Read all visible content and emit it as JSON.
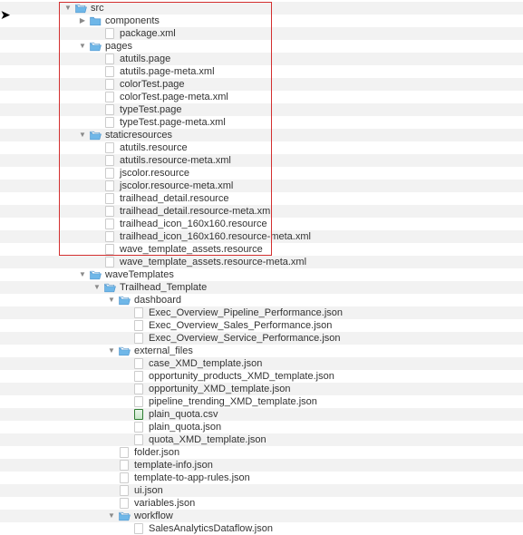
{
  "tree": [
    {
      "depth": 0,
      "arrow": "down",
      "icon": "folder-open",
      "label": "src",
      "interactable": true
    },
    {
      "depth": 1,
      "arrow": "right",
      "icon": "folder-closed",
      "label": "components",
      "interactable": true
    },
    {
      "depth": 2,
      "arrow": "",
      "icon": "file",
      "label": "package.xml",
      "interactable": true
    },
    {
      "depth": 1,
      "arrow": "down",
      "icon": "folder-open",
      "label": "pages",
      "interactable": true
    },
    {
      "depth": 2,
      "arrow": "",
      "icon": "file",
      "label": "atutils.page",
      "interactable": true
    },
    {
      "depth": 2,
      "arrow": "",
      "icon": "file",
      "label": "atutils.page-meta.xml",
      "interactable": true
    },
    {
      "depth": 2,
      "arrow": "",
      "icon": "file",
      "label": "colorTest.page",
      "interactable": true
    },
    {
      "depth": 2,
      "arrow": "",
      "icon": "file",
      "label": "colorTest.page-meta.xml",
      "interactable": true
    },
    {
      "depth": 2,
      "arrow": "",
      "icon": "file",
      "label": "typeTest.page",
      "interactable": true
    },
    {
      "depth": 2,
      "arrow": "",
      "icon": "file",
      "label": "typeTest.page-meta.xml",
      "interactable": true
    },
    {
      "depth": 1,
      "arrow": "down",
      "icon": "folder-open",
      "label": "staticresources",
      "interactable": true
    },
    {
      "depth": 2,
      "arrow": "",
      "icon": "file",
      "label": "atutils.resource",
      "interactable": true
    },
    {
      "depth": 2,
      "arrow": "",
      "icon": "file",
      "label": "atutils.resource-meta.xml",
      "interactable": true
    },
    {
      "depth": 2,
      "arrow": "",
      "icon": "file",
      "label": "jscolor.resource",
      "interactable": true
    },
    {
      "depth": 2,
      "arrow": "",
      "icon": "file",
      "label": "jscolor.resource-meta.xml",
      "interactable": true
    },
    {
      "depth": 2,
      "arrow": "",
      "icon": "file",
      "label": "trailhead_detail.resource",
      "interactable": true
    },
    {
      "depth": 2,
      "arrow": "",
      "icon": "file",
      "label": "trailhead_detail.resource-meta.xml",
      "interactable": true
    },
    {
      "depth": 2,
      "arrow": "",
      "icon": "file",
      "label": "trailhead_icon_160x160.resource",
      "interactable": true
    },
    {
      "depth": 2,
      "arrow": "",
      "icon": "file",
      "label": "trailhead_icon_160x160.resource-meta.xml",
      "interactable": true
    },
    {
      "depth": 2,
      "arrow": "",
      "icon": "file",
      "label": "wave_template_assets.resource",
      "interactable": true
    },
    {
      "depth": 2,
      "arrow": "",
      "icon": "file",
      "label": "wave_template_assets.resource-meta.xml",
      "interactable": true
    },
    {
      "depth": 1,
      "arrow": "down",
      "icon": "folder-open",
      "label": "waveTemplates",
      "interactable": true
    },
    {
      "depth": 2,
      "arrow": "down",
      "icon": "folder-open",
      "label": "Trailhead_Template",
      "interactable": true
    },
    {
      "depth": 3,
      "arrow": "down",
      "icon": "folder-open",
      "label": "dashboard",
      "interactable": true
    },
    {
      "depth": 4,
      "arrow": "",
      "icon": "file",
      "label": "Exec_Overview_Pipeline_Performance.json",
      "interactable": true
    },
    {
      "depth": 4,
      "arrow": "",
      "icon": "file",
      "label": "Exec_Overview_Sales_Performance.json",
      "interactable": true
    },
    {
      "depth": 4,
      "arrow": "",
      "icon": "file",
      "label": "Exec_Overview_Service_Performance.json",
      "interactable": true
    },
    {
      "depth": 3,
      "arrow": "down",
      "icon": "folder-open",
      "label": "external_files",
      "interactable": true
    },
    {
      "depth": 4,
      "arrow": "",
      "icon": "file",
      "label": "case_XMD_template.json",
      "interactable": true
    },
    {
      "depth": 4,
      "arrow": "",
      "icon": "file",
      "label": "opportunity_products_XMD_template.json",
      "interactable": true
    },
    {
      "depth": 4,
      "arrow": "",
      "icon": "file",
      "label": "opportunity_XMD_template.json",
      "interactable": true
    },
    {
      "depth": 4,
      "arrow": "",
      "icon": "file",
      "label": "pipeline_trending_XMD_template.json",
      "interactable": true
    },
    {
      "depth": 4,
      "arrow": "",
      "icon": "csv",
      "label": "plain_quota.csv",
      "interactable": true
    },
    {
      "depth": 4,
      "arrow": "",
      "icon": "file",
      "label": "plain_quota.json",
      "interactable": true
    },
    {
      "depth": 4,
      "arrow": "",
      "icon": "file",
      "label": "quota_XMD_template.json",
      "interactable": true
    },
    {
      "depth": 3,
      "arrow": "",
      "icon": "file",
      "label": "folder.json",
      "interactable": true
    },
    {
      "depth": 3,
      "arrow": "",
      "icon": "file",
      "label": "template-info.json",
      "interactable": true
    },
    {
      "depth": 3,
      "arrow": "",
      "icon": "file",
      "label": "template-to-app-rules.json",
      "interactable": true
    },
    {
      "depth": 3,
      "arrow": "",
      "icon": "file",
      "label": "ui.json",
      "interactable": true
    },
    {
      "depth": 3,
      "arrow": "",
      "icon": "file",
      "label": "variables.json",
      "interactable": true
    },
    {
      "depth": 3,
      "arrow": "down",
      "icon": "folder-open",
      "label": "workflow",
      "interactable": true
    },
    {
      "depth": 4,
      "arrow": "",
      "icon": "file",
      "label": "SalesAnalyticsDataflow.json",
      "interactable": true
    }
  ],
  "baseIndent": 70,
  "indentStep": 16
}
